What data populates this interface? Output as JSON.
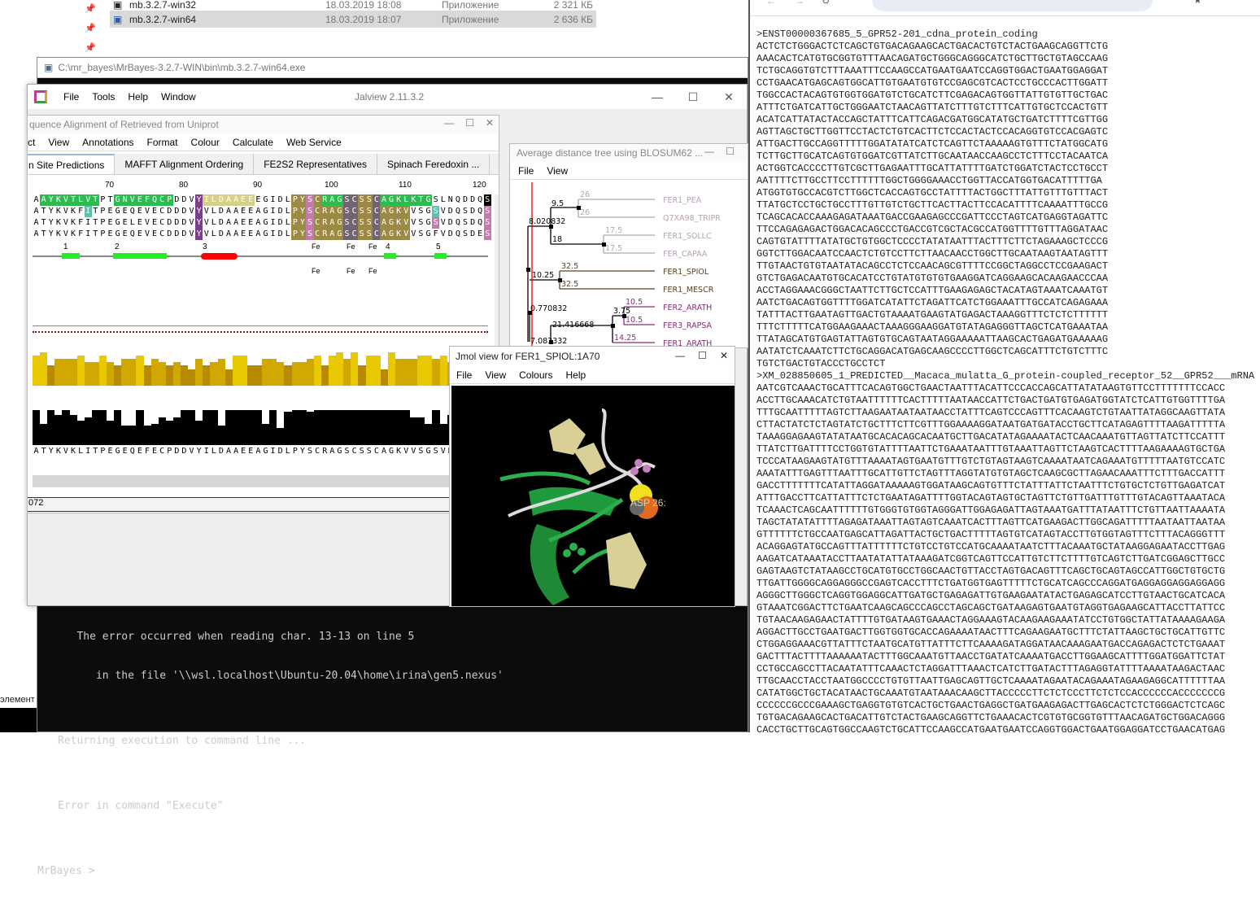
{
  "explorer": {
    "rows": [
      {
        "name": "mb.3.2.7-win32",
        "date": "18.03.2019 18:08",
        "type": "Приложение",
        "size": "2 321 КБ"
      },
      {
        "name": "mb.3.2.7-win64",
        "date": "18.03.2019 18:07",
        "type": "Приложение",
        "size": "2 636 КБ"
      }
    ],
    "side_text": "элемент"
  },
  "console": {
    "title": "C:\\mr_bayes\\MrBayes-3.2.7-WIN\\bin\\mb.3.2.7-win64.exe",
    "lines": [
      "   The error occurred when reading char. 13-13 on line 5",
      "      in the file '\\\\wsl.localhost\\Ubuntu-20.04\\home\\irina\\gen5.nexus'",
      "",
      "Returning execution to command line ...",
      "",
      "Error in command \"Execute\"",
      "",
      "MrBayes > "
    ]
  },
  "jalview": {
    "title": "Jalview 2.11.3.2",
    "menu": [
      "File",
      "Tools",
      "Help",
      "Window"
    ]
  },
  "alignment": {
    "title": "quence Alignment of Retrieved from Uniprot",
    "menu": [
      "ct",
      "View",
      "Annotations",
      "Format",
      "Colour",
      "Calculate",
      "Web Service"
    ],
    "tabs": [
      "n Site Predictions",
      "MAFFT Alignment Ordering",
      "FE2S2 Representatives",
      "Spinach Feredoxin ..."
    ],
    "ruler": [
      "70",
      "80",
      "90",
      "100",
      "110",
      "120"
    ],
    "sequences": [
      "AAYKVTLVTPTGNVEFQCPDDVYILDAAEEEGIDLPYSCRAGSCSSCAGKLKTGSLNQDDQS",
      "ATYKVKFITPEGEQEVECDDDVYVLDAAEEAGIDLPYSCRAGSCSSCAGKVVSGSVDQSDQS",
      "ATYKVKFITPEGELEVECDDDVYVLDAAEEAGIDLPYSCRAGSCSSCAGKVVSGSVDQSDQS",
      "ATYKVKFITPEGEQEVECDDDVYVLDAAEEAGIDLPYSCRAGSCSSCAGKVVSGFVDQSDES"
    ],
    "structure_labels": [
      "1",
      "2",
      "3",
      "4",
      "5"
    ],
    "fe_label": "Fe",
    "conservation": [
      9,
      10,
      6,
      8,
      8,
      8,
      9,
      7,
      7,
      9,
      7,
      6,
      8,
      8,
      9,
      6,
      8,
      7,
      6,
      7,
      6,
      5,
      8,
      6,
      7,
      8,
      5,
      9,
      9,
      6,
      6,
      8,
      8,
      7,
      6,
      7,
      7,
      8,
      9,
      6,
      9,
      10,
      8,
      10,
      6,
      9,
      9,
      5,
      10,
      8,
      8,
      8,
      9,
      9,
      8,
      9,
      7
    ],
    "consensus_pct": [
      100,
      60,
      100,
      85,
      100,
      85,
      70,
      80,
      100,
      100,
      70,
      100,
      55,
      55,
      100,
      55,
      60,
      80,
      70,
      80,
      100,
      100,
      70,
      100,
      100,
      55,
      100,
      100,
      100,
      100,
      100,
      60,
      100,
      50,
      95,
      100,
      100,
      95,
      100,
      100,
      100,
      100,
      100,
      100,
      100,
      100,
      100,
      100,
      100,
      100,
      100,
      80,
      80,
      60,
      100,
      60,
      85
    ],
    "consensus_seq": "ATYKVKLITPEGEQEFECPDDVYILDAAEEAGIDLPYSCRAGSCSSCAGKVVSGSVD",
    "status": "072"
  },
  "tree": {
    "title": "Average distance tree using BLOSUM62 ...",
    "menu": [
      "File",
      "View"
    ],
    "leaves": [
      "FER1_PEA",
      "Q7XA98_TRIPR",
      "FER1_SOLLC",
      "FER_CAPAA",
      "FER1_SPIOL",
      "FER1_MESCR",
      "FER2_ARATH",
      "FER3_RAPSA",
      "FER1_ARATH"
    ],
    "branch_labels": [
      "26",
      "26",
      "17.5",
      "17.5",
      "9.5",
      "8.020832",
      "18",
      "32.5",
      "32.5",
      "10.25",
      "10.5",
      "10.5",
      "3.75",
      "0.770832",
      "21.416668",
      "14.25",
      "7.083332"
    ],
    "colors": {
      "group1": "#b3a2b3",
      "group2": "#5a4020",
      "group3": "#8b2a7b"
    }
  },
  "jmol": {
    "title": "Jmol view for FER1_SPIOL:1A70",
    "menu": [
      "File",
      "View",
      "Colours",
      "Help"
    ],
    "label": "ASP 26:"
  },
  "browser": {
    "sequences": [
      ">ENST00000367685_5_GPR52-201_cdna_protein_coding",
      "ACTCTCTGGGACTCTCAGCTGTGACAGAAGCACTGACACTGTCTACTGAAGCAGGTTCTG",
      "AAACACTCATGTGCGGTGTTTAACAGATGCTGGGCAGGGCATCTGCTTGCTGTAGCCAAG",
      "TCTGCAGGTGTCTTTAAATTTCCAAGCCATGAATGAATCCAGGTGGACTGAATGGAGGAT",
      "CCTGAACATGAGCAGTGGCATTGTGAATGTGTCCGAGCGTCACTCCTGCCCACTTGGATT",
      "TGGCCACTACAGTGTGGTGGATGTCTGCATCTTCGAGACAGTGGTTATTGTGTTGCTGAC",
      "ATTTCTGATCATTGCTGGGAATCTAACAGTTATCTTTGTCTTTCATTGTGCTCCACTGTT",
      "ACATCATTATACTACCAGCTATTTCATTCAGACGATGGCATATGCTGATCTTTTCGTTGG",
      "AGTTAGCTGCTTGGTTCCTACTCTGTCACTTCTCCACTACTCCACAGGTGTCCACGAGTC",
      "ATTGACTTGCCAGGTTTTTGGATATATCATCTCAGTTCTAAAAAGTGTTTCTATGGCATG",
      "TCTTGCTTGCATCAGTGTGGATCGTTATCTTGCAATAACCAAGCCTCTTTCCTACAATCA",
      "ACTGGTCACCCCTTGTCGCTTGAGAATTTGCATTATTTTGATCTGGATCTACTCCTGCCT",
      "AATTTTCTTGCCTTCCTTTTTTGGCTGGGGAAACCTGGTTACCATGGTGACATTTTTGA",
      "ATGGTGTGCCACGTCTTGGCTCACCAGTGCCTATTTTACTGGCTTTATTGTTTGTTTACT",
      "TTATGCTCCTGCTGCCTTTGTTGTCTGCTTCACTTACTTCCACATTTTCAAAATTTGCCG",
      "TCAGCACACCAAAGAGATAAATGACCGAAGAGCCCGATTCCCTAGTCATGAGGTAGATTC",
      "TTCCAGAGAGACTGGACACAGCCCTGACCGTCGCTACGCCATGGTTTTGTTTAGGATAAC",
      "CAGTGTATTTTATATGCTGTGGCTCCCCTATATAATTTACTTTCTTCTAGAAAGCTCCCG",
      "GGTCTTGGACAATCCAACTCTGTCCTTCTTAACAACCTGGCTTGCAATAAGTAATAGTTT",
      "TTGTAACTGTGTAATATACAGCCTCTCCAACAGCGTTTTCCGGCTAGGCCTCCGAAGACT",
      "GTCTGAGACAATGTGCACATCCTGTATGTGTGTGAAGGATCAGGAAGCACAAGAACCCAA",
      "ACCTAGGAAACGGGCTAATTCTTGCTCCATTTGAAGAGAGCTACATAGTAAATCAAATGT",
      "AATCTGACAGTGGTTTTGGATCATATTCTAGATTCATCTGGAAATTTGCCATCAGAGAAA",
      "TATTTACTTGAATAGTTGACTGTAAAATGAAGTATGAGACTAAAGGTTTCTCTCTTTTTT",
      "TTTCTTTTTCATGGAAGAAACTAAAGGGAAGGATGTATAGAGGGTTAGCTCATGAAATAA",
      "TTATAGCATGTGAGTATTAGTGTGCAGTAATAGGAAAAATTAAGCACTGAGATGAAAAAG",
      "AATATCTCAAATCTTCTGCAGGACATGAGCAAGCCCCTTGGCTCAGCATTTCTGTCTTTC",
      "TGTCTGACTGTACCCTGCCTCT",
      ">XM_028850605_1_PREDICTED__Macaca_mulatta_G_protein-coupled_receptor_52__GPR52___mRNA",
      "AATCGTCAAACTGCATTTCACAGTGGCTGAACTAATTTACATTCCCACCAGCATTATATAAGTGTTCCTTTTTTTCCACC",
      "ACCTTGCAAACATCTGTAATTTTTTCACTTTTTAATAACCATTCTGACTGATGTGAGATGGTATCTCATTGTGGTTTTGA",
      "TTTGCAATTTTTAGTCTTAAGAATAATAATAACCTATTTCAGTCCCAGTTTCACAAGTCTGTAATTATAGGCAAGTTATA",
      "CTTACTATCTCTAGTATCTGCTTTCTTCGTTTGGAAAAGGATAATGATGATACCTGCTTCATAGAGTTTTAAGATTTTTA",
      "TAAAGGAGAAGTATATAATGCACACAGCACAATGCTTGACATATAGAAAATACTCAACAAATGTTAGTTATCTTCCATTT",
      "TTATCTTGATTTTCCTGGTGTATTTTAATTCTGAAATAATTTGTAAATTAGTTCTAAGTCACTTTTAAGAAAAGTGCTGA",
      "TCCCATAAGAAGTATGTTTAAAATAGTGAATGTTTGTCTGTAGTAAGTCAAAATAATCAGAAATGTTTTTAATGTCCATC",
      "AAATATTTGAGTTTAATTTGCATTGTTCTAGTTTAGGTATGTGTAGCTCAAGCGCTTAGAACAAATTTCTTTGACCATTT",
      "GACCTTTTTTTCATATTAGGATAAAAAGTGGATAAGCAGTGTTTCTATTTATTCTAATTTCTGTGCTCTGTTGAGATCAT",
      "ATTTGACCTTCATTATTTCTCTGAATAGATTTTGGTACAGTAGTGCTAGTTCTGTTGATTTGTTTGTACAGTTAAATACA",
      "TCAAACTCAGCAATTTTTTGTGGGTGTGGTAGGGATTGGAGAGATTAGTAAATGATTTATAATTTCTGTTAATTAAAATA",
      "TAGCTATATATTTTAGAGATAAATTAGTAGTCAAATCACTTTAGTTCATGAAGACTTGGCAGATTTTTAATAATTAATAA",
      "GTTTTTTCTGCCAATGAGCATTAGATTACTGCTGACTTTTTAGTGTCATAGTACCTTGTGGTAGTTTCTTTACAGGGTTT",
      "ACAGGAGTATGCCAGTTTATTTTTTCTGTCCTGTCCATGCAAAATAATCTTTACAAATGCTATAAGGAGAATACCTTGAG",
      "AAGATCATAAATACCTTAATATATTATAAAGATCGGTCAGTTCCATTGTCTTCTTTTGTCAGTCTTGATCGGAGCTTGCC",
      "GAGTAAGTCTATAAGCCTGCATGTGCCTGGCAACTGTTACCTAGTGACAGTTTCAGCTGCAGTAGCCATTGGCTGTGCTG",
      "TTGATTGGGGCAGGAGGGCCGAGTCACCTTTCTGATGGTGAGTTTTTCTGCATCAGCCCAGGATGAGGAGGAGGAGGAGG",
      "AGGGCTTGGGCTCAGGTGGAGGCATTGATGCTGAGAGATTGTGAAGAATATACTGAGAGCATCCTTGTAACTGCATCACA",
      "GTAAATCGGACTTCTGAATCAAGCAGCCCAGCCTAGCAGCTGATAAGAGTGAATGTAGGTGAGAAGCATTACCTTATTCC",
      "TGTAACAAGAGAACTATTTTGTGATAAGTGAAACTAGGAAAGTACAAGAAGAAATATCCTGTGGCTATTATAAAAGAAGA",
      "AGGACTTGCCTGAATGACTTGGTGGTGCACCAGAAAATAACTTTCAGAAGAATGCTTTCTATTAAGCTGCTGCATTGTTC",
      "CTGGAGGAAACGTTATTTCTAATGCATGTTATTTCTTCAAAAGATAGGATAACAAAGAATGACCAGAGACTCTCTGAAAT",
      "GACTTTACTTTTAAAAAATACTTTGGCAAATGTTAACCTGATATCAAAATGACCTTGGAAGCATTTTGGATGGATTCTAT",
      "CCTGCCAGCCTTACAATATTTCAAACTCTAGGATTTAAACTCATCTTGATACTTTAGAGGTATTTTAAAATAAGACTAAC",
      "TTGCAACCTACCTAATGGCCCCTGTGTTAATTGAGCAGTTGCTCAAAATAGAATACAGAAATAGAAGAGGCATTTTTTAA",
      "CATATGGCTGCTACATAACTGCAAATGTAATAAACAAGCTTACCCCCTTCTCTCCCTTCTCTCCACCCCCCACCCCCCCG",
      "CCCCCCGCCCGAAAGCTGAGGTGTGTCACTGCTGAACTGAGGCTGATGAAGAGACTTGAGCACTCTCTGGGACTCTCAGC",
      "TGTGACAGAAGCACTGACATTGTCTACTGAAGCAGGTTCTGAAACACTCGTGTGCGGTGTTTAACAGATGCTGGACAGGG",
      "CACCTGCTTGCAGTGGCCAAGTCTGCATTCCAAGCCATGAATGAATCCAGGTGGACTGAATGGAGGATCCTGAACATGAG"
    ]
  }
}
